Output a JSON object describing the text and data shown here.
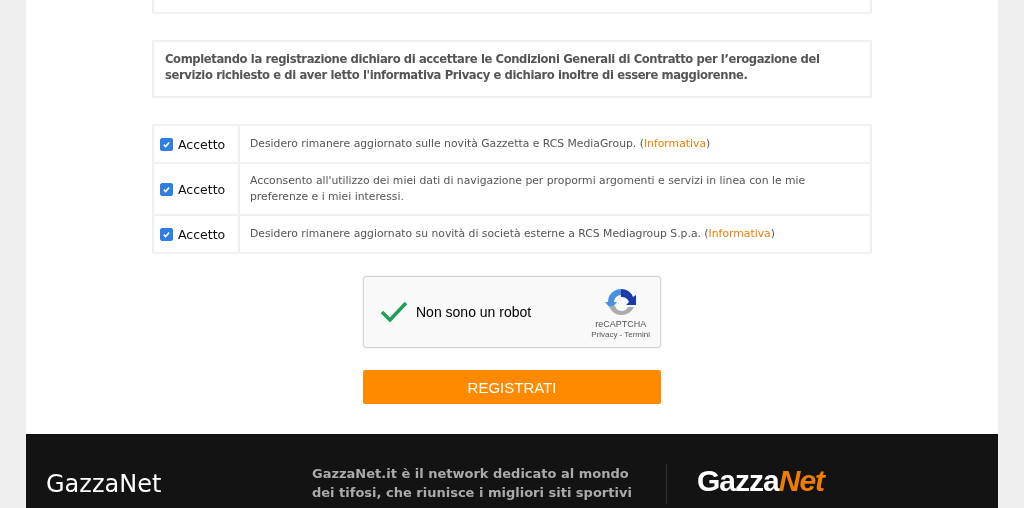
{
  "terms": "Completando la registrazione dichiaro di accettare le Condizioni Generali di Contratto per l’erogazione del servizio richiesto e di aver letto l'informativa Privacy e dichiaro inoltre di essere maggiorenne.",
  "consents": [
    {
      "label": "Accetto",
      "checked": true,
      "text": "Desidero rimanere aggiornato sulle novità Gazzetta e RCS MediaGroup. (",
      "link": "Informativa",
      "after": ")"
    },
    {
      "label": "Accetto",
      "checked": true,
      "text": "Acconsento all'utilizzo dei miei dati di navigazione per propormi argomenti e servizi in linea con le mie preferenze e i miei interessi."
    },
    {
      "label": "Accetto",
      "checked": true,
      "text": "Desidero rimanere aggiornato su novità di società esterne a RCS Mediagroup S.p.a. (",
      "link": "Informativa",
      "after": ")"
    }
  ],
  "captcha": {
    "checked": true,
    "label": "Non sono un robot",
    "brand": "reCAPTCHA",
    "privacy": "Privacy",
    "separator": "-",
    "terms": "Termini"
  },
  "submit": "REGISTRATI",
  "footer": {
    "title": "GazzaNet",
    "description": "GazzaNet.it è il network dedicato al mondo dei tifosi, che riunisce i migliori siti sportivi",
    "logo_left": "Gazza",
    "logo_right": "Net"
  }
}
